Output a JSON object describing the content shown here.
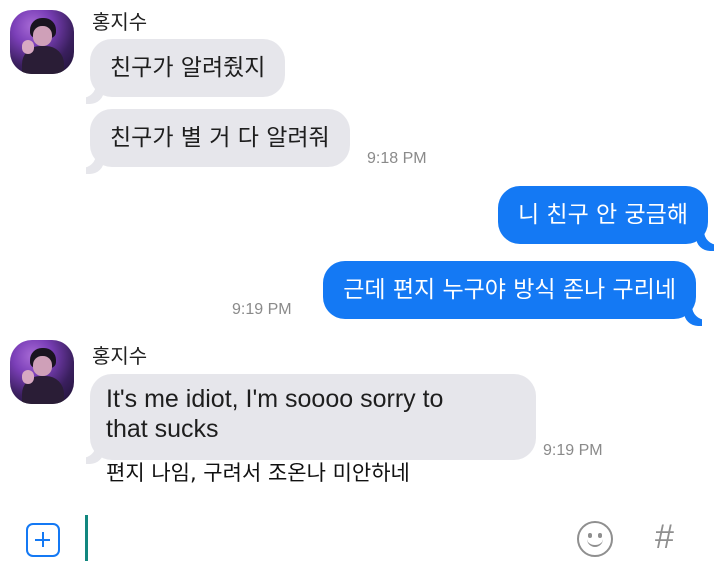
{
  "chat": {
    "contact_name": "홍지수",
    "messages": [
      {
        "side": "in",
        "text": "친구가 알려줬지"
      },
      {
        "side": "in",
        "text": "친구가 별 거 다 알려줘",
        "time": "9:18 PM"
      },
      {
        "side": "out",
        "text": "니 친구 안 궁금해"
      },
      {
        "side": "out",
        "text": "근데 편지 누구야 방식 존나 구리네",
        "time": "9:19 PM"
      },
      {
        "side": "in",
        "line1": "It's me idiot, I'm soooo sorry to",
        "line2": "that sucks",
        "caption": "편지 나임, 구려서 조온나 미안하네",
        "time": "9:19 PM"
      }
    ]
  },
  "composer": {
    "add_icon": "plus-square-icon",
    "emoji_icon": "smiley-icon",
    "hash_symbol": "#"
  },
  "colors": {
    "outgoing_bubble": "#1479f4",
    "incoming_bubble": "#e6e6eb",
    "cursor": "#12877f"
  }
}
